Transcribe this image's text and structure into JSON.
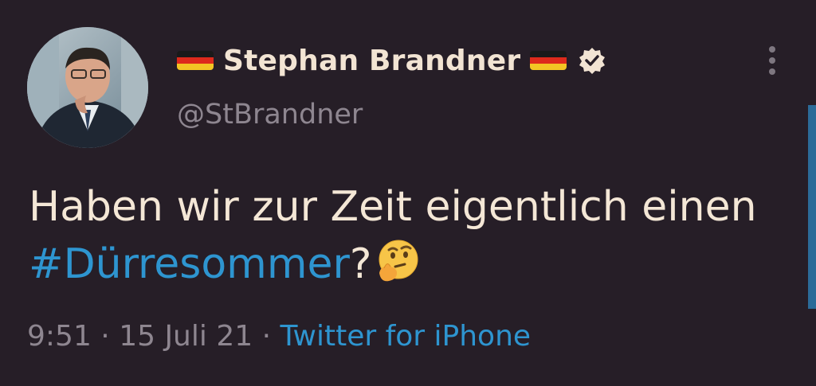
{
  "author": {
    "display_name": "Stephan Brandner",
    "handle": "@StBrandner",
    "verified": true,
    "flag": "german-flag",
    "flag_colors": [
      "#1a1a1a",
      "#dd2a1c",
      "#f3c524"
    ]
  },
  "tweet": {
    "text_part": "Haben wir zur Zeit eigentlich einen ",
    "hashtag": "#Dürresommer",
    "punctuation": "?",
    "emoji": "thinking-face-emoji"
  },
  "meta": {
    "time": "9:51",
    "separator_1": " · ",
    "date": "15 Juli 21",
    "separator_2": " · ",
    "source": "Twitter for iPhone"
  },
  "colors": {
    "background": "#261e27",
    "text": "#f4e7d6",
    "link": "#2e95d0",
    "muted": "#8e8690"
  }
}
